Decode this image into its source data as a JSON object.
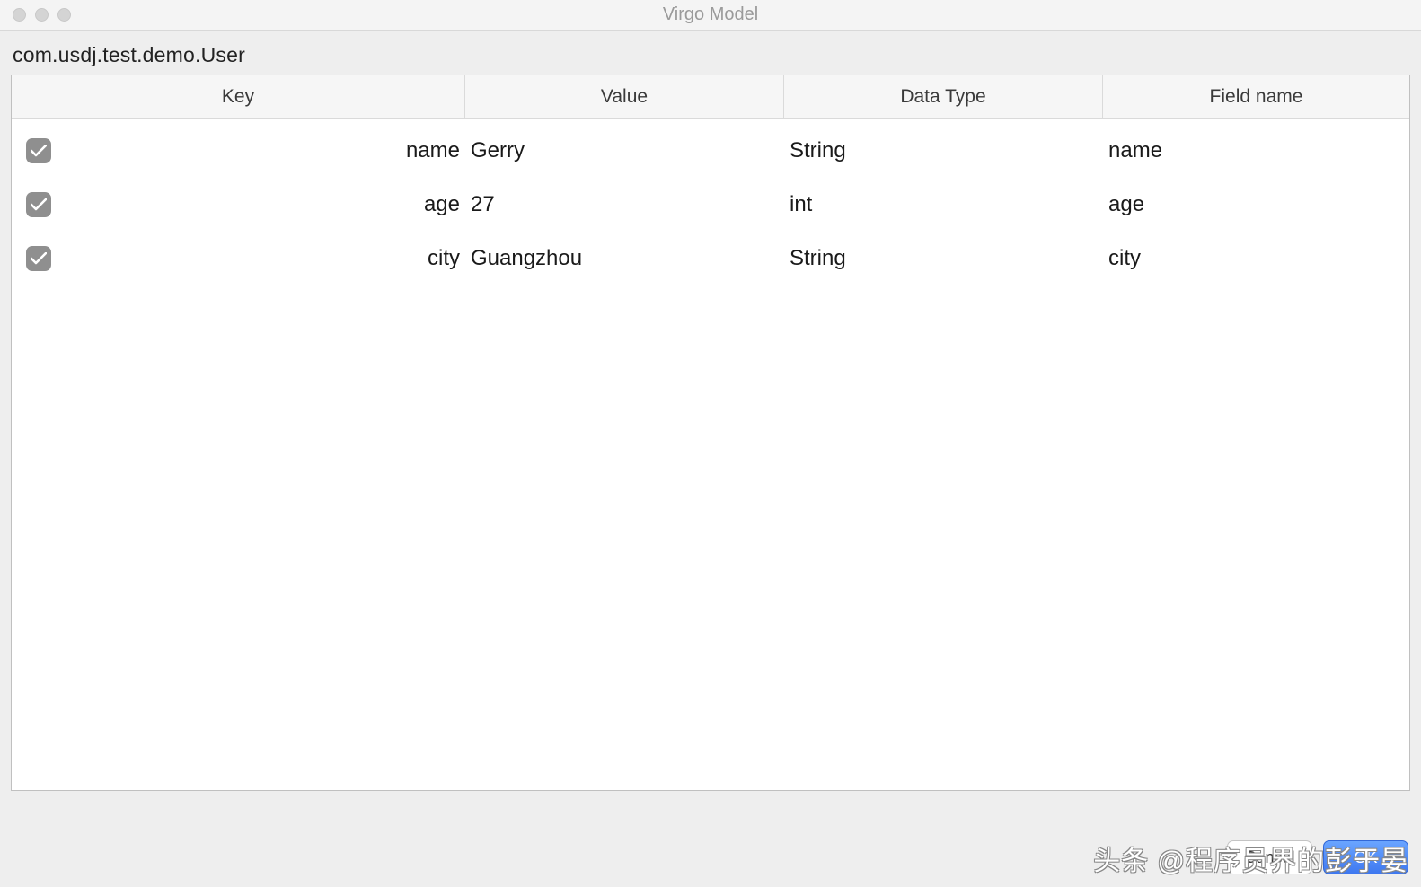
{
  "window": {
    "title": "Virgo Model"
  },
  "header": {
    "class_path": "com.usdj.test.demo.User"
  },
  "table": {
    "headers": {
      "key": "Key",
      "value": "Value",
      "data_type": "Data Type",
      "field_name": "Field name"
    },
    "rows": [
      {
        "checked": true,
        "key": "name",
        "value": "Gerry",
        "type": "String",
        "field": "name"
      },
      {
        "checked": true,
        "key": "age",
        "value": "27",
        "type": "int",
        "field": "age"
      },
      {
        "checked": true,
        "key": "city",
        "value": "Guangzhou",
        "type": "String",
        "field": "city"
      }
    ]
  },
  "footer": {
    "cancel": "Cancel",
    "ok": "OK"
  },
  "watermark": "头条 @程序员界的彭于晏"
}
